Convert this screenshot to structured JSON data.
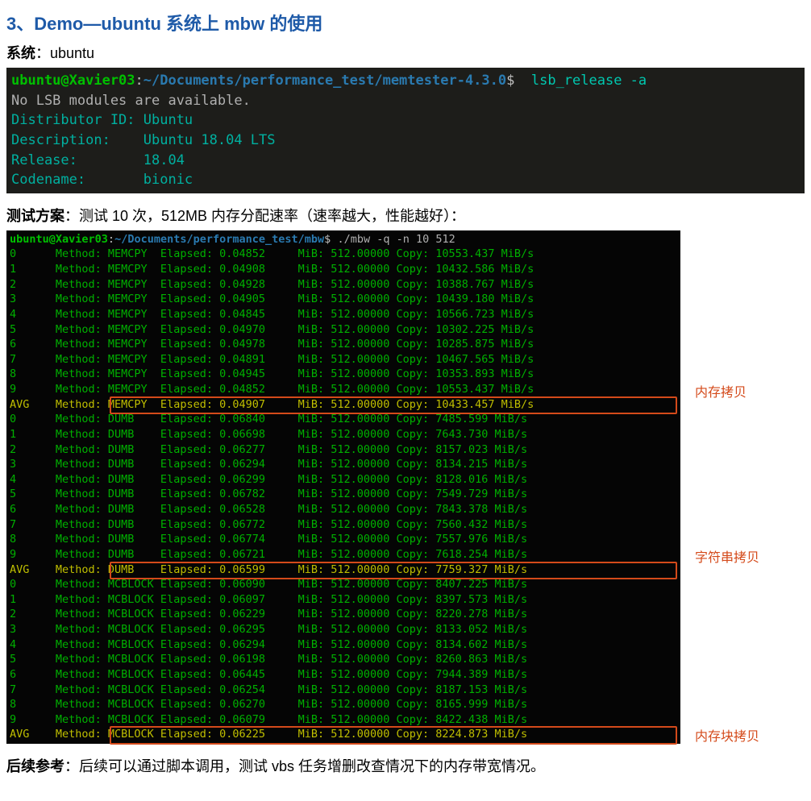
{
  "heading": "3、Demo—ubuntu 系统上 mbw 的使用",
  "system_label": "系统",
  "system_sep": "：",
  "system_value": "ubuntu",
  "term1": {
    "prompt_user": "ubuntu@Xavier03",
    "prompt_path": "~/Documents/performance_test/memtester-4.3.0",
    "cmd": "lsb_release -a",
    "lines": [
      "No LSB modules are available.",
      "Distributor ID: Ubuntu",
      "Description:    Ubuntu 18.04 LTS",
      "Release:        18.04",
      "Codename:       bionic"
    ]
  },
  "plan_label": "测试方案",
  "plan_sep": "：",
  "plan_text": "测试 10 次，512MB 内存分配速率（速率越大，性能越好）：",
  "term2": {
    "prompt_user": "ubuntu@Xavier03",
    "prompt_path": "~/Documents/performance_test/mbw",
    "cmd": "./mbw -q -n 10 512",
    "rows": [
      {
        "idx": "0",
        "method": "MEMCPY",
        "elapsed": "0.04852",
        "mib": "512.00000",
        "copy": "10553.437 MiB/s",
        "avg": false
      },
      {
        "idx": "1",
        "method": "MEMCPY",
        "elapsed": "0.04908",
        "mib": "512.00000",
        "copy": "10432.586 MiB/s",
        "avg": false
      },
      {
        "idx": "2",
        "method": "MEMCPY",
        "elapsed": "0.04928",
        "mib": "512.00000",
        "copy": "10388.767 MiB/s",
        "avg": false
      },
      {
        "idx": "3",
        "method": "MEMCPY",
        "elapsed": "0.04905",
        "mib": "512.00000",
        "copy": "10439.180 MiB/s",
        "avg": false
      },
      {
        "idx": "4",
        "method": "MEMCPY",
        "elapsed": "0.04845",
        "mib": "512.00000",
        "copy": "10566.723 MiB/s",
        "avg": false
      },
      {
        "idx": "5",
        "method": "MEMCPY",
        "elapsed": "0.04970",
        "mib": "512.00000",
        "copy": "10302.225 MiB/s",
        "avg": false
      },
      {
        "idx": "6",
        "method": "MEMCPY",
        "elapsed": "0.04978",
        "mib": "512.00000",
        "copy": "10285.875 MiB/s",
        "avg": false
      },
      {
        "idx": "7",
        "method": "MEMCPY",
        "elapsed": "0.04891",
        "mib": "512.00000",
        "copy": "10467.565 MiB/s",
        "avg": false
      },
      {
        "idx": "8",
        "method": "MEMCPY",
        "elapsed": "0.04945",
        "mib": "512.00000",
        "copy": "10353.893 MiB/s",
        "avg": false
      },
      {
        "idx": "9",
        "method": "MEMCPY",
        "elapsed": "0.04852",
        "mib": "512.00000",
        "copy": "10553.437 MiB/s",
        "avg": false
      },
      {
        "idx": "AVG",
        "method": "MEMCPY",
        "elapsed": "0.04907",
        "mib": "512.00000",
        "copy": "10433.457 MiB/s",
        "avg": true
      },
      {
        "idx": "0",
        "method": "DUMB",
        "elapsed": "0.06840",
        "mib": "512.00000",
        "copy": "7485.599 MiB/s",
        "avg": false
      },
      {
        "idx": "1",
        "method": "DUMB",
        "elapsed": "0.06698",
        "mib": "512.00000",
        "copy": "7643.730 MiB/s",
        "avg": false
      },
      {
        "idx": "2",
        "method": "DUMB",
        "elapsed": "0.06277",
        "mib": "512.00000",
        "copy": "8157.023 MiB/s",
        "avg": false
      },
      {
        "idx": "3",
        "method": "DUMB",
        "elapsed": "0.06294",
        "mib": "512.00000",
        "copy": "8134.215 MiB/s",
        "avg": false
      },
      {
        "idx": "4",
        "method": "DUMB",
        "elapsed": "0.06299",
        "mib": "512.00000",
        "copy": "8128.016 MiB/s",
        "avg": false
      },
      {
        "idx": "5",
        "method": "DUMB",
        "elapsed": "0.06782",
        "mib": "512.00000",
        "copy": "7549.729 MiB/s",
        "avg": false
      },
      {
        "idx": "6",
        "method": "DUMB",
        "elapsed": "0.06528",
        "mib": "512.00000",
        "copy": "7843.378 MiB/s",
        "avg": false
      },
      {
        "idx": "7",
        "method": "DUMB",
        "elapsed": "0.06772",
        "mib": "512.00000",
        "copy": "7560.432 MiB/s",
        "avg": false
      },
      {
        "idx": "8",
        "method": "DUMB",
        "elapsed": "0.06774",
        "mib": "512.00000",
        "copy": "7557.976 MiB/s",
        "avg": false
      },
      {
        "idx": "9",
        "method": "DUMB",
        "elapsed": "0.06721",
        "mib": "512.00000",
        "copy": "7618.254 MiB/s",
        "avg": false
      },
      {
        "idx": "AVG",
        "method": "DUMB",
        "elapsed": "0.06599",
        "mib": "512.00000",
        "copy": "7759.327 MiB/s",
        "avg": true
      },
      {
        "idx": "0",
        "method": "MCBLOCK",
        "elapsed": "0.06090",
        "mib": "512.00000",
        "copy": "8407.225 MiB/s",
        "avg": false
      },
      {
        "idx": "1",
        "method": "MCBLOCK",
        "elapsed": "0.06097",
        "mib": "512.00000",
        "copy": "8397.573 MiB/s",
        "avg": false
      },
      {
        "idx": "2",
        "method": "MCBLOCK",
        "elapsed": "0.06229",
        "mib": "512.00000",
        "copy": "8220.278 MiB/s",
        "avg": false
      },
      {
        "idx": "3",
        "method": "MCBLOCK",
        "elapsed": "0.06295",
        "mib": "512.00000",
        "copy": "8133.052 MiB/s",
        "avg": false
      },
      {
        "idx": "4",
        "method": "MCBLOCK",
        "elapsed": "0.06294",
        "mib": "512.00000",
        "copy": "8134.602 MiB/s",
        "avg": false
      },
      {
        "idx": "5",
        "method": "MCBLOCK",
        "elapsed": "0.06198",
        "mib": "512.00000",
        "copy": "8260.863 MiB/s",
        "avg": false
      },
      {
        "idx": "6",
        "method": "MCBLOCK",
        "elapsed": "0.06445",
        "mib": "512.00000",
        "copy": "7944.389 MiB/s",
        "avg": false
      },
      {
        "idx": "7",
        "method": "MCBLOCK",
        "elapsed": "0.06254",
        "mib": "512.00000",
        "copy": "8187.153 MiB/s",
        "avg": false
      },
      {
        "idx": "8",
        "method": "MCBLOCK",
        "elapsed": "0.06270",
        "mib": "512.00000",
        "copy": "8165.999 MiB/s",
        "avg": false
      },
      {
        "idx": "9",
        "method": "MCBLOCK",
        "elapsed": "0.06079",
        "mib": "512.00000",
        "copy": "8422.438 MiB/s",
        "avg": false
      },
      {
        "idx": "AVG",
        "method": "MCBLOCK",
        "elapsed": "0.06225",
        "mib": "512.00000",
        "copy": "8224.873 MiB/s",
        "avg": true
      }
    ]
  },
  "annotations": {
    "memcpy": "内存拷贝",
    "dumb": "字符串拷贝",
    "mcblock": "内存块拷贝"
  },
  "followup_label": "后续参考",
  "followup_sep": "：",
  "followup_text": "后续可以通过脚本调用，测试 vbs 任务增删改查情况下的内存带宽情况。"
}
